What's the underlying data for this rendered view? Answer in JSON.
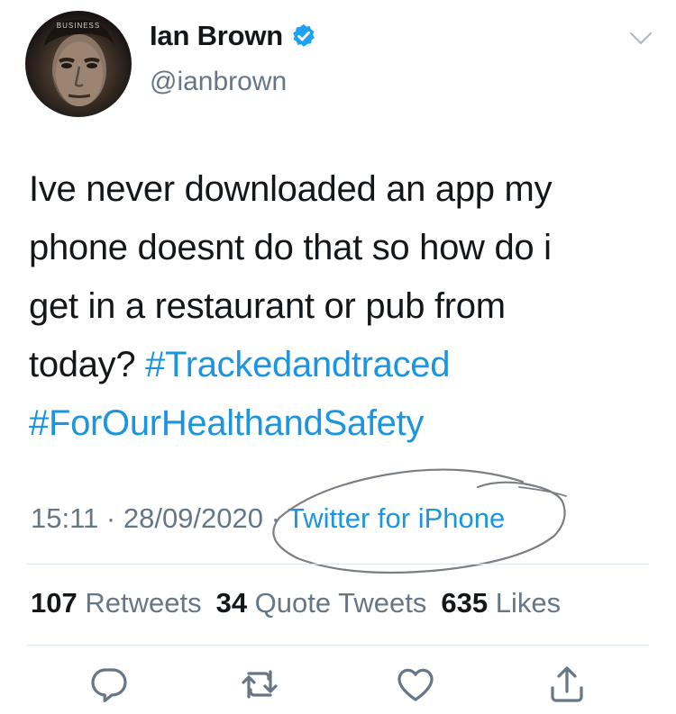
{
  "user": {
    "display_name": "Ian Brown",
    "handle": "@ianbrown",
    "avatar_caption": "BUSINESS"
  },
  "tweet": {
    "text_plain": "Ive never downloaded an app my\nphone doesnt do that so how  do i\nget in a restaurant or pub from\ntoday? ",
    "hashtag_1": "#Trackedandtraced",
    "hashtag_2": "#ForOurHealthandSafety"
  },
  "meta": {
    "time": "15:11",
    "separator_1": " · ",
    "date": "28/09/2020",
    "separator_2": " · ",
    "source": "Twitter for iPhone"
  },
  "stats": {
    "retweets_count": "107",
    "retweets_label": " Retweets",
    "quotes_count": "34",
    "quotes_label": " Quote Tweets",
    "likes_count": "635",
    "likes_label": " Likes"
  },
  "icons": {
    "chevron": "chevron-down-icon",
    "verified": "verified-badge-icon",
    "reply": "reply-icon",
    "retweet": "retweet-icon",
    "like": "like-icon",
    "share": "share-icon"
  },
  "colors": {
    "link": "#1b95e0",
    "muted": "#657786",
    "text": "#14171a",
    "verified": "#1da1f2",
    "icon": "#657786"
  }
}
